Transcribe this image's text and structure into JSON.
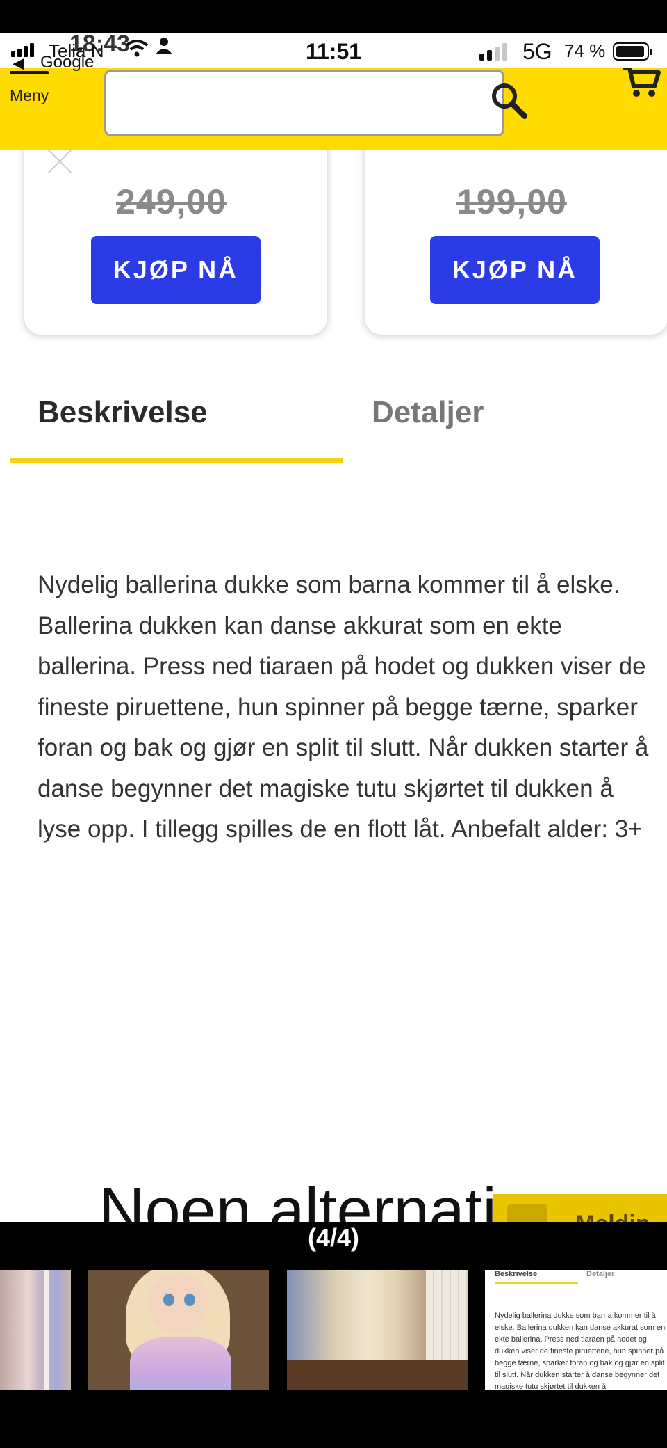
{
  "status_bar": {
    "carrier": "Telia N",
    "ghost_time": "18:43",
    "back_app": "Google",
    "time": "11:51",
    "network": "5G",
    "battery_text": "74 %"
  },
  "header": {
    "menu_label": "Meny",
    "search_value": "",
    "accent_color": "#ffdb00"
  },
  "products": [
    {
      "old_price": "249,00",
      "buy_label": "KJØP NÅ"
    },
    {
      "old_price": "199,00",
      "buy_label": "KJØP NÅ"
    }
  ],
  "tabs": {
    "items": [
      "Beskrivelse",
      "Detaljer"
    ],
    "active": "Beskrivelse"
  },
  "description": "Nydelig ballerina dukke som barna kommer til å elske. Ballerina dukken kan danse akkurat som en ekte ballerina. Press ned tiaraen på hodet og dukken viser de fineste piruettene, hun spinner på begge tærne, sparker foran og bak og gjør en split til slutt. Når dukken starter å danse begynner det magiske tutu skjørtet til dukken å lyse opp. I tillegg spilles de en flott låt. Anbefalt alder: 3+",
  "alternatives_heading": "Noen alternati",
  "message_button": "Meldin",
  "gallery": {
    "counter": "(4/4)",
    "thumb4_tabs": [
      "Beskrivelse",
      "Detaljer"
    ],
    "thumb4_text": "Nydelig ballerina dukke som barna kommer til å elske. Ballerina dukken kan danse akkurat som en ekte ballerina. Press ned tiaraen på hodet og dukken viser de fineste piruettene, hun spinner på begge tærne, sparker foran og bak og gjør en split til slutt. Når dukken starter å danse begynner det magiske tutu skjørtet til dukken å"
  },
  "icons": [
    "signal-icon",
    "wifi-icon",
    "person-icon",
    "battery-icon",
    "menu-icon",
    "search-icon",
    "cart-icon",
    "close-icon",
    "mail-icon"
  ]
}
